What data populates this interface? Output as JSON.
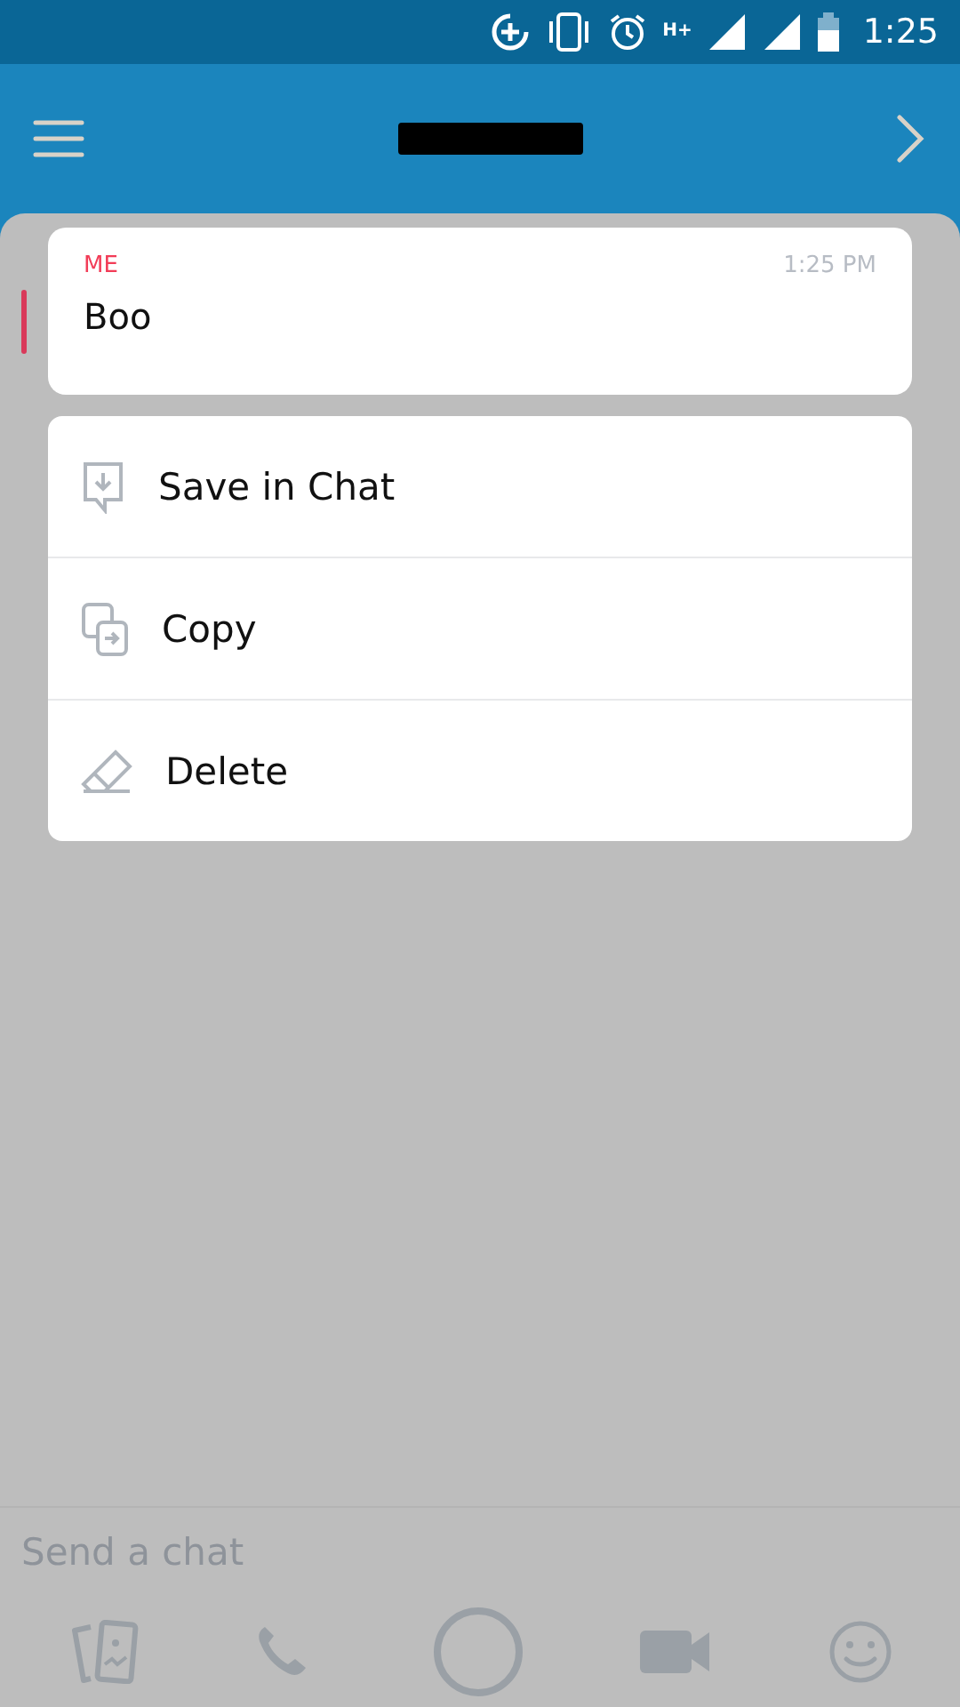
{
  "status_bar": {
    "network": "H+",
    "time": "1:25"
  },
  "message": {
    "sender": "ME",
    "time": "1:25 PM",
    "text": "Boo"
  },
  "menu": [
    {
      "kind": "save",
      "label": "Save in Chat"
    },
    {
      "kind": "copy",
      "label": "Copy"
    },
    {
      "kind": "delete",
      "label": "Delete"
    }
  ],
  "composer": {
    "placeholder": "Send a chat"
  }
}
